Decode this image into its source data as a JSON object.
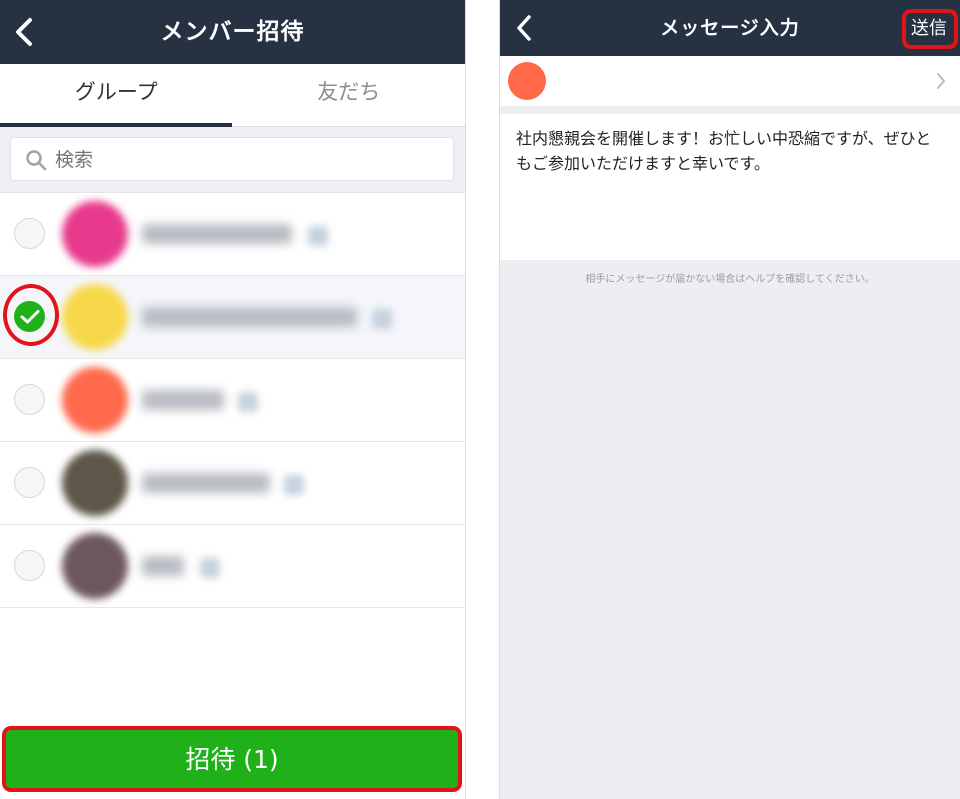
{
  "left": {
    "title": "メンバー招待",
    "tabs": [
      {
        "label": "グループ",
        "active": true
      },
      {
        "label": "友だち",
        "active": false
      }
    ],
    "search": {
      "placeholder": "検索"
    },
    "groups": [
      {
        "selected": false,
        "avatar_color": "#e83a8c"
      },
      {
        "selected": true,
        "avatar_color": "#f7d84a"
      },
      {
        "selected": false,
        "avatar_color": "#ff6a4d"
      },
      {
        "selected": false,
        "avatar_color": "#5e5648"
      },
      {
        "selected": false,
        "avatar_color": "#6e5660"
      }
    ],
    "invite_button": "招待 (1)"
  },
  "right": {
    "title": "メッセージ入力",
    "send_button": "送信",
    "recipient_color": "#ff6849",
    "message": "社内懇親会を開催します！お忙しい中恐縮ですが、ぜひともご参加いただけますと幸いです。",
    "hint": "相手にメッセージが届かない場合はヘルプを確認してください。"
  },
  "colors": {
    "navbar": "#263142",
    "accent_green": "#1fb01a",
    "highlight_red": "#e2141b"
  }
}
